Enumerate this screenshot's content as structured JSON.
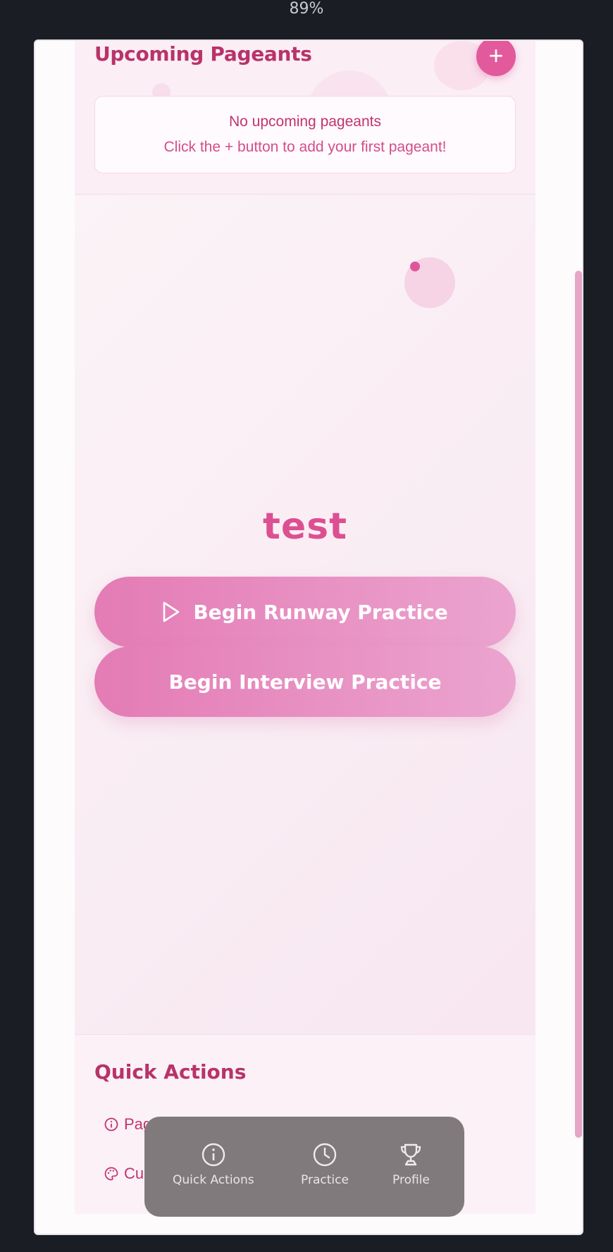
{
  "browser": {
    "zoom": "89%"
  },
  "upcoming": {
    "title": "Upcoming Pageants",
    "add_label": "+",
    "empty_title": "No upcoming pageants",
    "empty_subtitle": "Click the + button to add your first pageant!"
  },
  "hero": {
    "title": "test",
    "runway_button": "Begin Runway Practice",
    "interview_button": "Begin Interview Practice"
  },
  "quick_actions": {
    "title": "Quick Actions",
    "items": [
      {
        "label": "Pag",
        "icon": "info-icon"
      },
      {
        "label": "Cu",
        "icon": "palette-icon"
      }
    ]
  },
  "tabbar": {
    "items": [
      {
        "label": "Quick Actions",
        "icon": "info-icon"
      },
      {
        "label": "Practice",
        "icon": "clock-icon"
      },
      {
        "label": "Profile",
        "icon": "trophy-icon"
      }
    ]
  },
  "colors": {
    "accent": "#e25a9c",
    "heading": "#b8336a",
    "button_start": "#e47bb5",
    "button_end": "#eba4cf",
    "background": "#fbf0f6",
    "tabbar": "#807a7d",
    "scrollbar": "#e6a6c7"
  }
}
